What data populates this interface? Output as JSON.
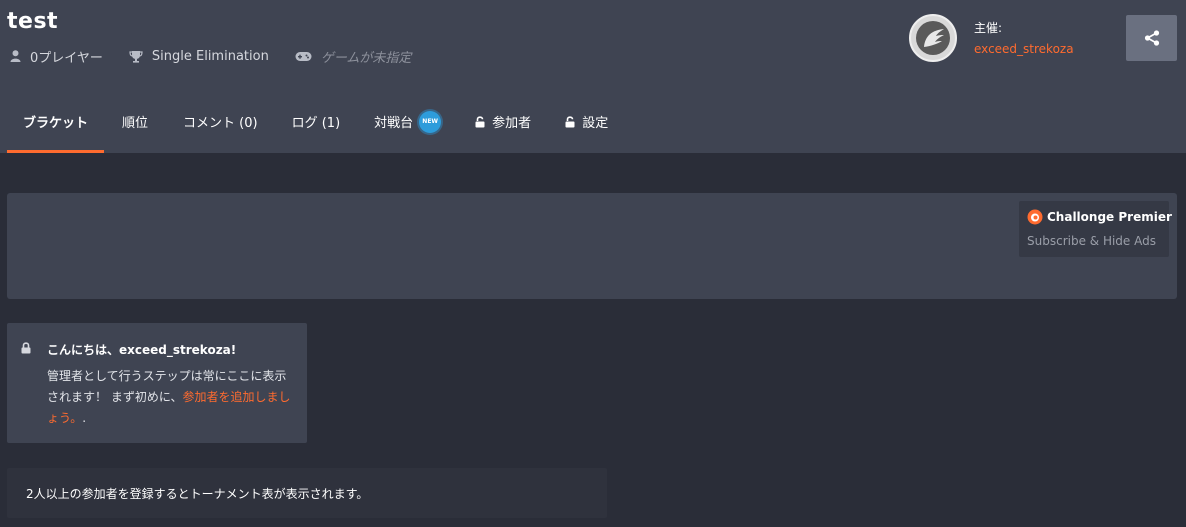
{
  "tournament": {
    "title": "test",
    "players": "0プレイヤー",
    "format": "Single Elimination",
    "game": "ゲームが未指定"
  },
  "host": {
    "label": "主催:",
    "name": "exceed_strekoza"
  },
  "tabs": [
    {
      "label": "ブラケット",
      "active": true
    },
    {
      "label": "順位"
    },
    {
      "label": "コメント (0)"
    },
    {
      "label": "ログ (1)"
    },
    {
      "label": "対戦台",
      "badge": "NEW"
    },
    {
      "label": "参加者",
      "icon": "unlock-icon"
    },
    {
      "label": "設定",
      "icon": "unlock-icon"
    }
  ],
  "premier": {
    "title": "Challonge Premier",
    "subtitle": "Subscribe & Hide Ads"
  },
  "welcome": {
    "title": "こんにちは、exceed_strekoza!",
    "body_prefix": "管理者として行うステップは常にここに表示されます！ まず初めに、",
    "link": "参加者を追加しましょう。",
    "body_suffix": "."
  },
  "notice": "2人以上の参加者を登録するとトーナメント表が表示されます。",
  "colors": {
    "accent": "#ff6b2f",
    "header_bg": "#3f4452",
    "page_bg": "#2a2d38",
    "badge_blue": "#2d9cdb"
  }
}
